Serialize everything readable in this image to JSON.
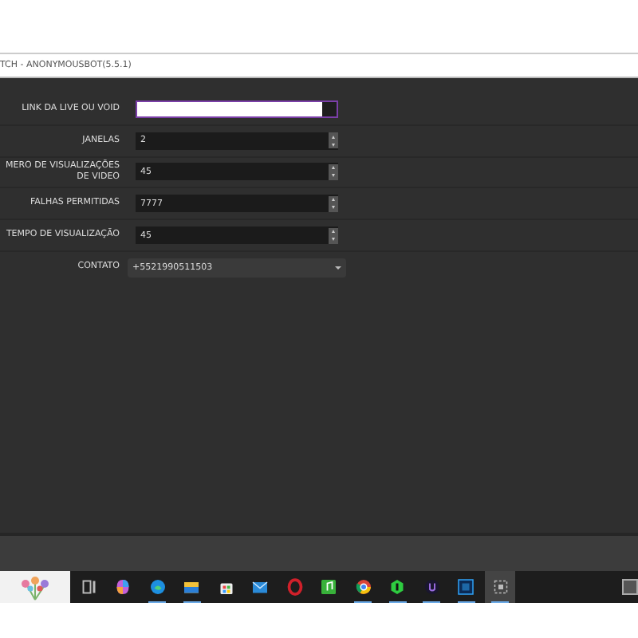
{
  "window": {
    "title": "TCH - ANONYMOUSBOT(5.5.1)"
  },
  "fields": [
    {
      "kind": "text",
      "label": "LINK DA LIVE OU VOID",
      "focused": true
    },
    {
      "kind": "spin",
      "label": "JANELAS",
      "value": "2",
      "focused": false
    },
    {
      "kind": "spin",
      "label": "MERO DE VISUALIZAÇÕES DE VIDEO",
      "value": "45",
      "focused": false
    },
    {
      "kind": "spin",
      "label": "FALHAS PERMITIDAS",
      "value": "7777",
      "focused": false
    },
    {
      "kind": "spin",
      "label": "TEMPO DE VISUALIZAÇÃO",
      "value": "45",
      "focused": false
    },
    {
      "kind": "select",
      "label": "CONTATO",
      "value": "+5521990511503",
      "focused": false
    }
  ],
  "taskbar": {
    "apps": [
      {
        "kind": "taskview",
        "running": false
      },
      {
        "kind": "copilot",
        "running": false
      },
      {
        "kind": "edge",
        "running": true
      },
      {
        "kind": "folder",
        "running": true
      },
      {
        "kind": "store",
        "running": false
      },
      {
        "kind": "mail",
        "running": false
      },
      {
        "kind": "opera",
        "running": false
      },
      {
        "kind": "music",
        "running": false
      },
      {
        "kind": "chrome",
        "running": true
      },
      {
        "kind": "hex",
        "running": true
      },
      {
        "kind": "purple",
        "running": true
      },
      {
        "kind": "ps",
        "running": true
      },
      {
        "kind": "capture",
        "running": true
      }
    ]
  }
}
